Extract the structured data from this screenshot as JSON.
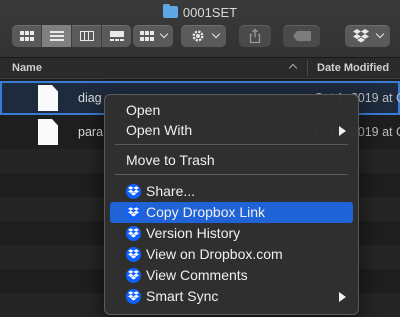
{
  "window": {
    "title": "0001SET"
  },
  "toolbar": {
    "view_buttons": [
      "icon-view",
      "list-view",
      "column-view",
      "gallery-view"
    ],
    "group_button": "group-menu",
    "action_button": "action-menu",
    "share_button": "share",
    "tags_button": "tags",
    "dropbox_button": "dropbox-menu"
  },
  "columns": {
    "name": "Name",
    "date_modified": "Date Modified"
  },
  "files": [
    {
      "name": "diag",
      "date": "Oct 1, 2019 at C"
    },
    {
      "name": "para",
      "date": "Oct 1, 2019 at C"
    }
  ],
  "context_menu": {
    "items": [
      {
        "label": "Open"
      },
      {
        "label": "Open With"
      },
      {
        "label": "Move to Trash"
      },
      {
        "label": "Share..."
      },
      {
        "label": "Copy Dropbox Link"
      },
      {
        "label": "Version History"
      },
      {
        "label": "View on Dropbox.com"
      },
      {
        "label": "View Comments"
      },
      {
        "label": "Smart Sync"
      }
    ],
    "highlighted": "Copy Dropbox Link"
  },
  "colors": {
    "highlight": "#1f63d7",
    "dropbox_blue": "#0f61ff",
    "folder_blue": "#5fa8e6"
  }
}
